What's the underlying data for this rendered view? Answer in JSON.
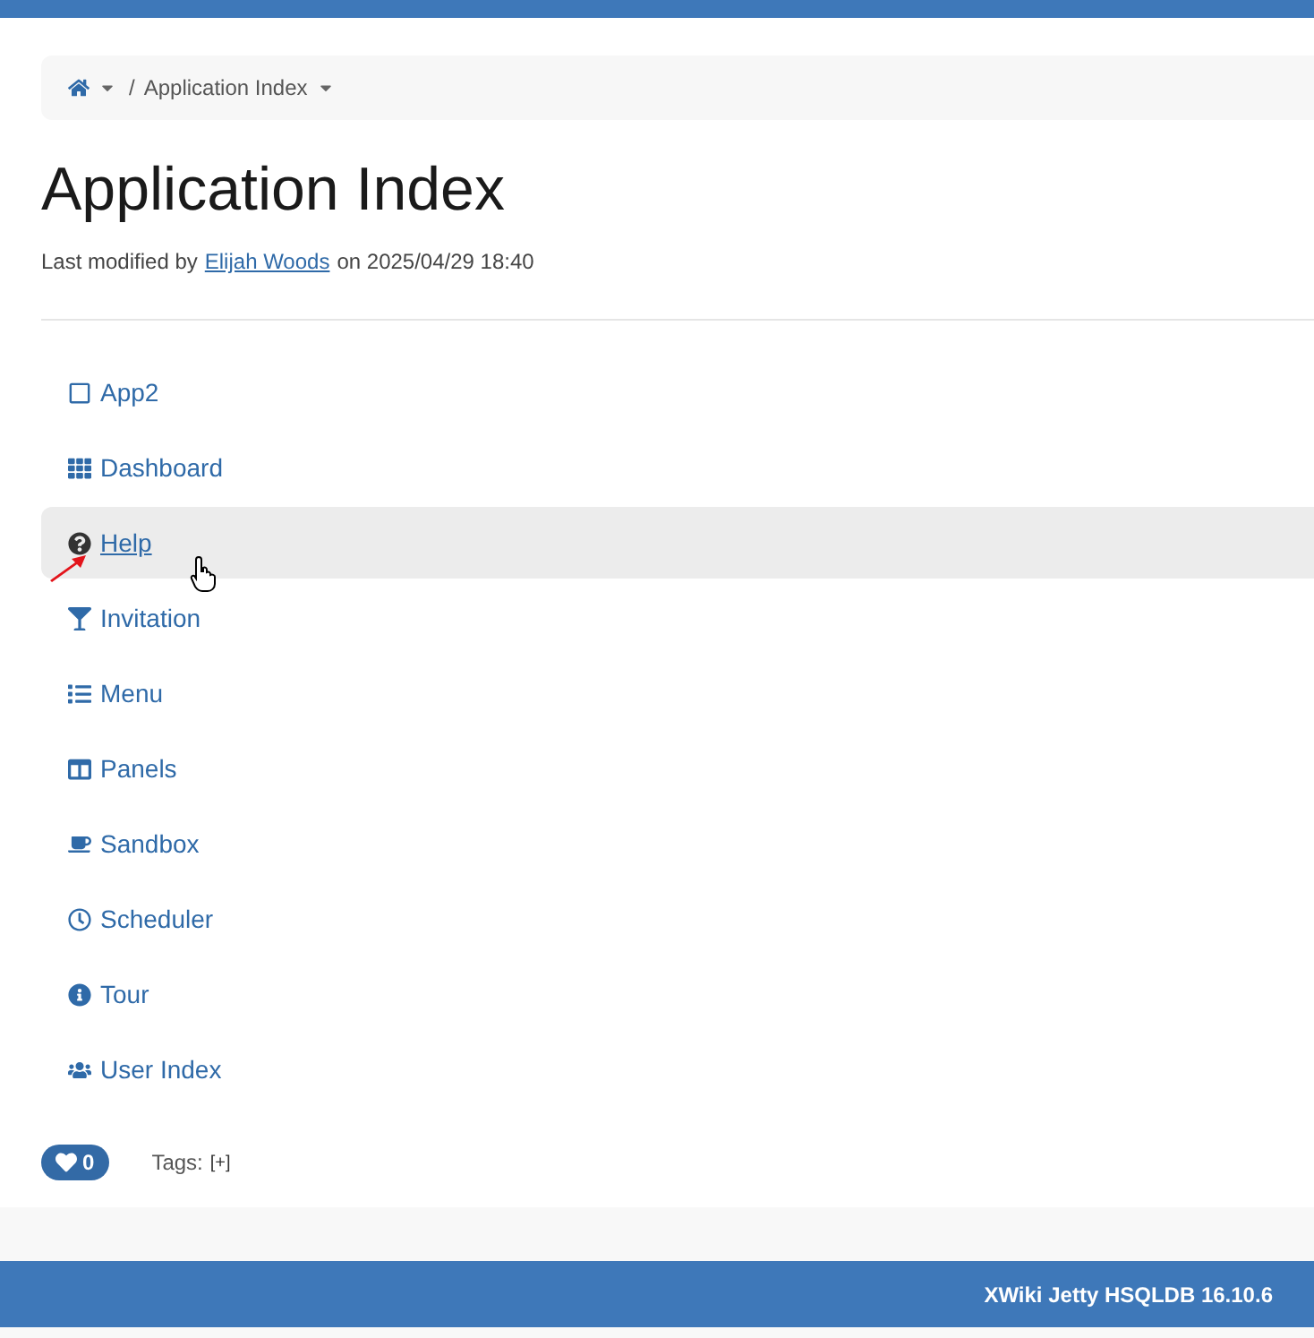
{
  "breadcrumb": {
    "separator": "/",
    "current": "Application Index"
  },
  "title": "Application Index",
  "meta": {
    "prefix": "Last modified by",
    "author": "Elijah Woods",
    "suffix": "on 2025/04/29 18:40"
  },
  "apps": [
    {
      "label": "App2",
      "highlighted": false
    },
    {
      "label": "Dashboard",
      "highlighted": false
    },
    {
      "label": "Help",
      "highlighted": true
    },
    {
      "label": "Invitation",
      "highlighted": false
    },
    {
      "label": "Menu",
      "highlighted": false
    },
    {
      "label": "Panels",
      "highlighted": false
    },
    {
      "label": "Sandbox",
      "highlighted": false
    },
    {
      "label": "Scheduler",
      "highlighted": false
    },
    {
      "label": "Tour",
      "highlighted": false
    },
    {
      "label": "User Index",
      "highlighted": false
    }
  ],
  "likes": {
    "count": "0"
  },
  "tags": {
    "label": "Tags:",
    "add": "[+]"
  },
  "footer": {
    "version": "XWiki Jetty HSQLDB 16.10.6"
  }
}
